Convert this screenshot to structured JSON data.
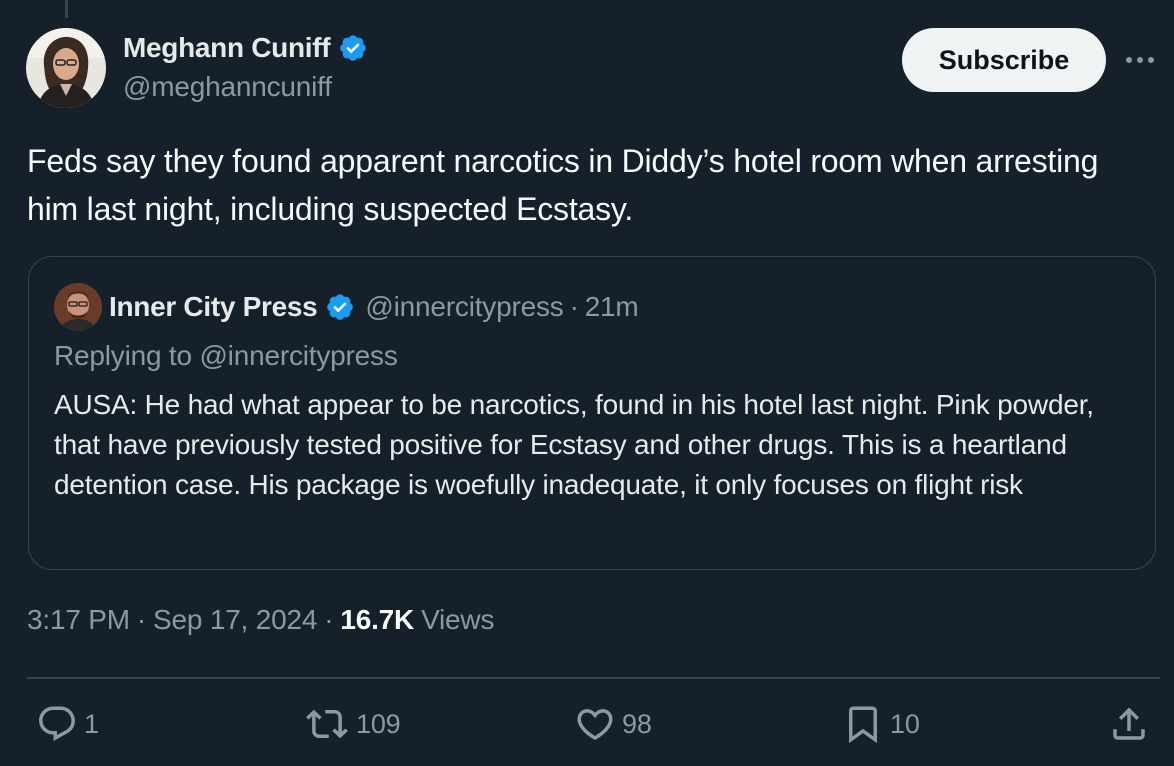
{
  "tweet": {
    "author": {
      "name": "Meghann Cuniff",
      "handle": "@meghanncuniff",
      "verified": true
    },
    "subscribe_label": "Subscribe",
    "more_icon": "ellipsis-icon",
    "text": "Feds say they found apparent narcotics in Diddy’s hotel room when arresting him last night, including suspected Ecstasy.",
    "quote": {
      "author_name": "Inner City Press",
      "handle": "@innercitypress",
      "separator": "·",
      "time": "21m",
      "replying_to": "Replying to @innercitypress",
      "text": "AUSA: He had what appear to be narcotics, found in his hotel last night. Pink powder, that have previously tested positive for Ecstasy and other drugs. This is a heartland detention case. His package is woefully inadequate, it only focuses on flight risk"
    },
    "meta": {
      "time": "3:17 PM",
      "separator": "·",
      "date": "Sep 17, 2024",
      "views_count": "16.7K",
      "views_label": "Views"
    },
    "actions": {
      "reply_count": "1",
      "retweet_count": "109",
      "like_count": "98",
      "bookmark_count": "10"
    }
  },
  "colors": {
    "background": "#15202b",
    "text_primary": "#f7f9f9",
    "text_secondary": "#8b98a5",
    "border": "#38444d",
    "verified_blue": "#1d9bf0",
    "button_bg": "#eff3f4"
  }
}
